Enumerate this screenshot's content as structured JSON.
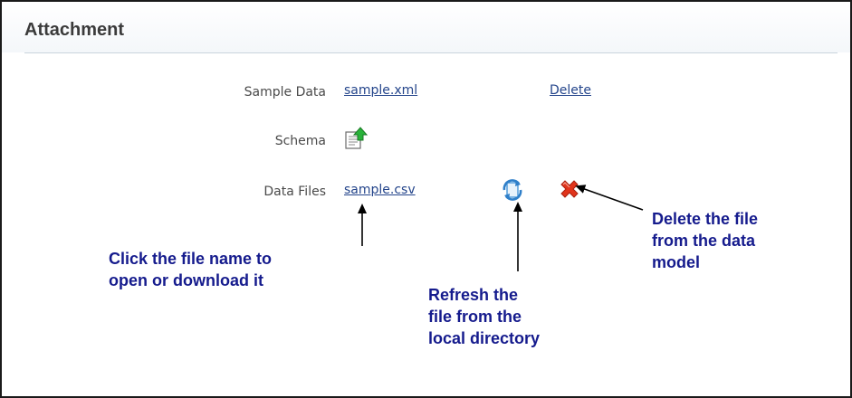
{
  "panel": {
    "title": "Attachment"
  },
  "rows": {
    "sample_data": {
      "label": "Sample Data",
      "file": "sample.xml",
      "action": "Delete"
    },
    "schema": {
      "label": "Schema",
      "icon": "upload-document-icon"
    },
    "data_files": {
      "label": "Data Files",
      "file": "sample.csv",
      "refresh_icon": "refresh-icon",
      "delete_icon": "delete-x-icon"
    }
  },
  "annotations": {
    "filename_note": {
      "line1": "Click the file name to",
      "line2": "open or download it"
    },
    "refresh_note": {
      "line1": "Refresh the",
      "line2": "file from the",
      "line3": "local directory"
    },
    "delete_note": {
      "line1": "Delete the file",
      "line2": "from the data",
      "line3": "model"
    }
  },
  "colors": {
    "link": "#24458b",
    "annotation": "#151b8d",
    "delete_x": "#e1341b",
    "refresh": "#3b8fd6"
  }
}
